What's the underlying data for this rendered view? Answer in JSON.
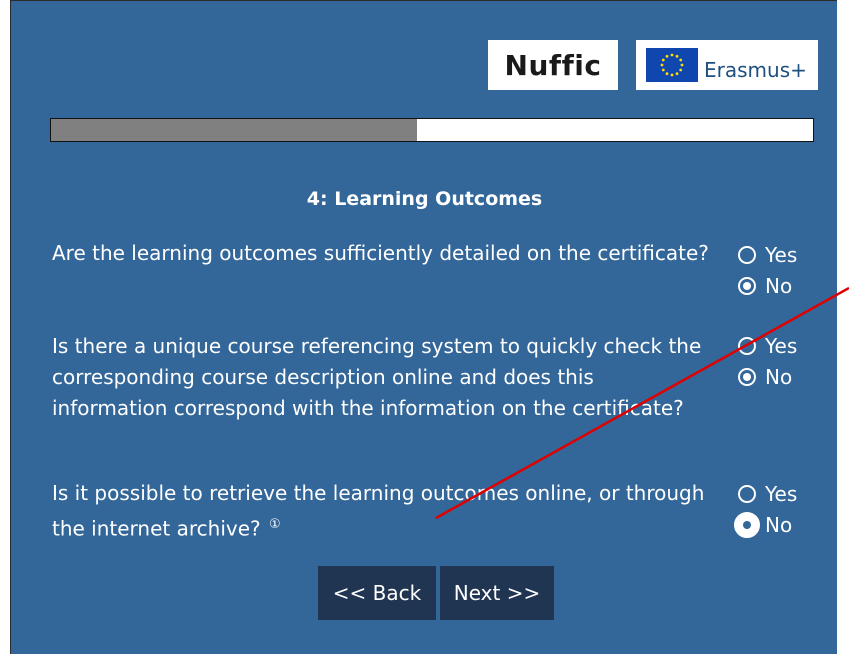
{
  "logos": {
    "nuffic": "Nuffic",
    "erasmus": "Erasmus+"
  },
  "progress": {
    "fraction": 0.48
  },
  "section": {
    "title": "4: Learning Outcomes"
  },
  "questions": [
    {
      "text": "Are the learning outcomes sufficiently detailed on the certificate?",
      "options": [
        "Yes",
        "No"
      ],
      "selected": "No"
    },
    {
      "text": "Is there a unique course referencing system to quickly check the corresponding course description online and does this information correspond with the information on the certificate?",
      "options": [
        "Yes",
        "No"
      ],
      "selected": "No"
    },
    {
      "text": "Is it possible to retrieve the learning outcomes online, or through the internet archive?",
      "info": "①",
      "options": [
        "Yes",
        "No"
      ],
      "selected": "No"
    }
  ],
  "buttons": {
    "back": "<< Back",
    "next": "Next >>"
  },
  "annotation": {
    "color": "#e00000"
  }
}
